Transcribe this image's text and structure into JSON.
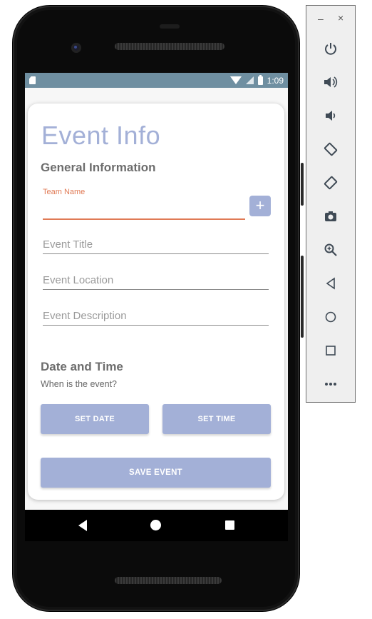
{
  "statusbar": {
    "time": "1:09"
  },
  "app": {
    "title": "Event Info",
    "general_heading": "General Information",
    "team_name_label": "Team Name",
    "add_button_label": "+",
    "fields": [
      {
        "placeholder": "Event Title"
      },
      {
        "placeholder": "Event Location"
      },
      {
        "placeholder": "Event Description"
      }
    ],
    "datetime_heading": "Date and Time",
    "datetime_sub": "When is the event?",
    "set_date_label": "SET DATE",
    "set_time_label": "SET TIME",
    "save_label": "SAVE EVENT"
  },
  "emulator_toolbar": {
    "minimize": "–",
    "close": "×",
    "icons": [
      "power-icon",
      "volume-up-icon",
      "volume-down-icon",
      "rotate-left-icon",
      "rotate-right-icon",
      "camera-icon",
      "zoom-icon",
      "back-icon",
      "home-icon",
      "overview-icon",
      "more-icon"
    ]
  },
  "colors": {
    "accent": "#a3b0d7",
    "focus": "#e07a55",
    "statusbar": "#6f8fa1"
  }
}
